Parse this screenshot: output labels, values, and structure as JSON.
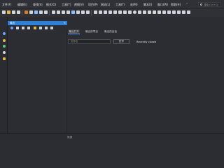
{
  "menubar": {
    "items": [
      "文件(F)",
      "编辑(E)",
      "查找(S)",
      "格式(O)",
      "工具(T)",
      "视图(V)",
      "项目(P)",
      "网站(L)",
      "工具(T)",
      "宏(M)",
      "脚本(I)",
      "窗口(W)",
      "帮助(H)"
    ],
    "search_placeholder": "搜索(Ctrl+Q)"
  },
  "panel": {
    "title": "输出",
    "pin_label": "",
    "close_label": "✕"
  },
  "tabs": [
    "最近打开",
    "最近的项目",
    "最近的会话"
  ],
  "open_dialog": {
    "input_placeholder": "文件名",
    "open_button": "打开",
    "recent_label": "Recently closed"
  },
  "status": {
    "text": "就绪"
  },
  "colors": {
    "accent": "#2f7fd6",
    "background": "#2b2d33",
    "chrome": "#2f3137"
  },
  "icons": {
    "left_strip": [
      "blue-dot-icon",
      "star-icon",
      "globe-icon",
      "world-icon",
      "folder-icon"
    ]
  }
}
